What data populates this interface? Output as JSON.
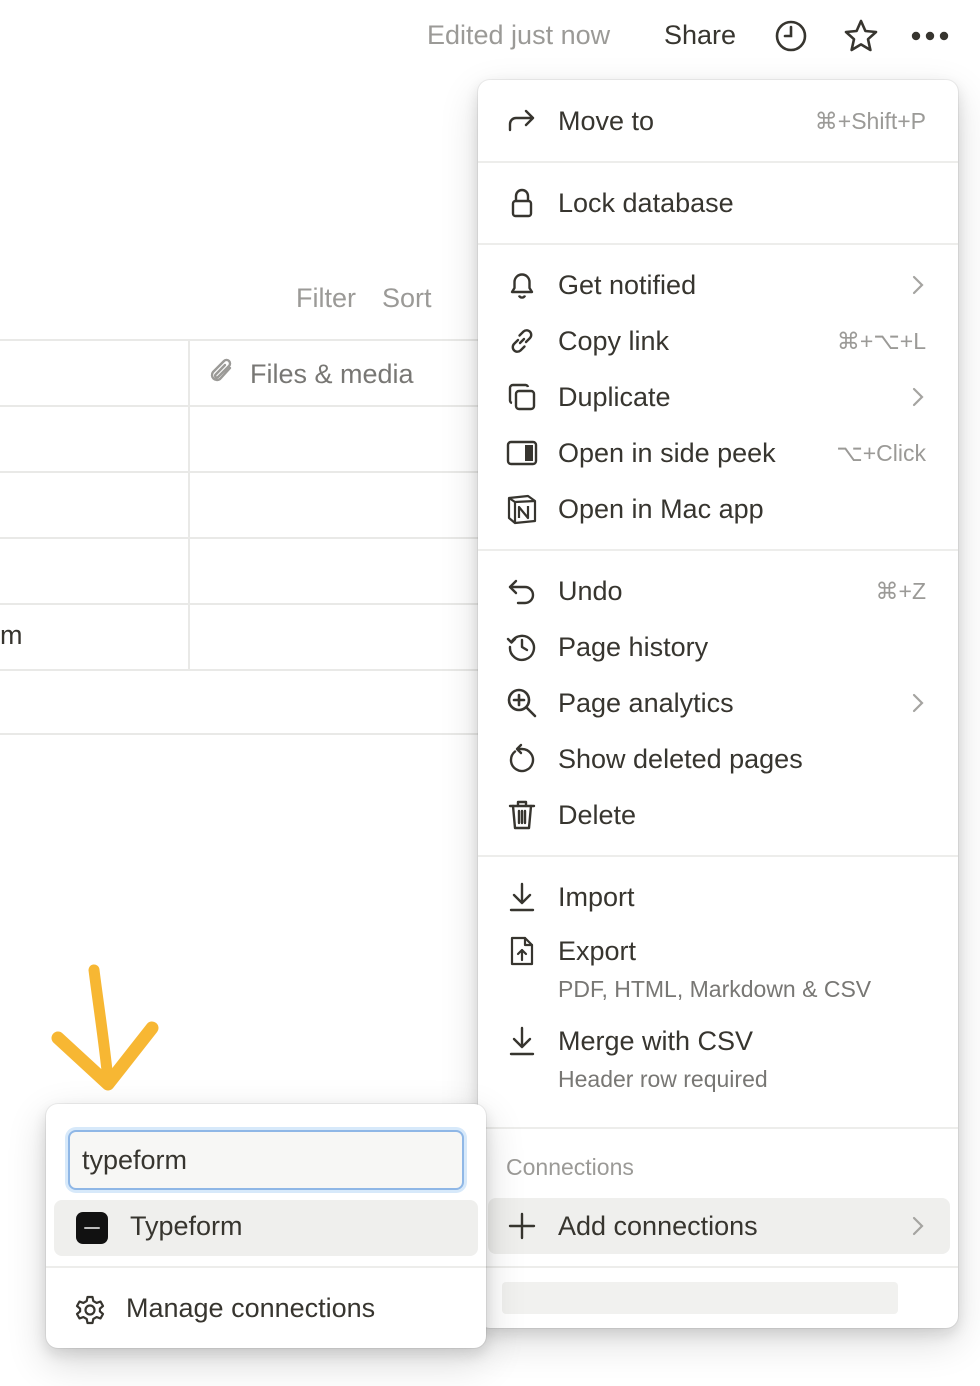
{
  "topbar": {
    "edited": "Edited just now",
    "share": "Share",
    "icons": [
      "clock-icon",
      "star-icon",
      "more-icon"
    ]
  },
  "table": {
    "filter": "Filter",
    "sort": "Sort",
    "column_header": "Files & media",
    "cell_fragment": "m"
  },
  "menu": {
    "items": [
      {
        "label": "Move to",
        "shortcut": "⌘+Shift+P",
        "icon": "move-arrow-icon"
      },
      {
        "label": "Lock database",
        "icon": "lock-icon"
      },
      {
        "label": "Get notified",
        "icon": "bell-icon",
        "chevron": true
      },
      {
        "label": "Copy link",
        "shortcut": "⌘+⌥+L",
        "icon": "link-icon"
      },
      {
        "label": "Duplicate",
        "icon": "duplicate-icon",
        "chevron": true
      },
      {
        "label": "Open in side peek",
        "shortcut": "⌥+Click",
        "icon": "side-peek-icon"
      },
      {
        "label": "Open in Mac app",
        "icon": "notion-app-icon"
      },
      {
        "label": "Undo",
        "shortcut": "⌘+Z",
        "icon": "undo-icon"
      },
      {
        "label": "Page history",
        "icon": "history-icon"
      },
      {
        "label": "Page analytics",
        "icon": "analytics-icon",
        "chevron": true
      },
      {
        "label": "Show deleted pages",
        "icon": "restore-icon"
      },
      {
        "label": "Delete",
        "icon": "trash-icon"
      },
      {
        "label": "Import",
        "icon": "import-icon"
      },
      {
        "label": "Export",
        "sublabel": "PDF, HTML, Markdown & CSV",
        "icon": "export-icon"
      },
      {
        "label": "Merge with CSV",
        "sublabel": "Header row required",
        "icon": "merge-icon"
      }
    ],
    "connections_label": "Connections",
    "add_connections": "Add connections"
  },
  "popup": {
    "search_value": "typeform",
    "result_label": "Typeform",
    "manage_label": "Manage connections"
  },
  "colors": {
    "text": "#37352f",
    "muted": "#9b9a97",
    "focus_ring": "#8fb7e6",
    "highlight": "#efefed",
    "arrow": "#f7b733"
  }
}
